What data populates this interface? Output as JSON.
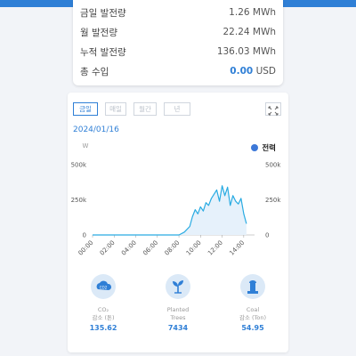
{
  "summary": {
    "rows": [
      {
        "label": "금일 발전량",
        "value": "1.26 MWh"
      },
      {
        "label": "월 발전량",
        "value": "22.24 MWh"
      },
      {
        "label": "누적 발전량",
        "value": "136.03 MWh"
      },
      {
        "label": "총 수입",
        "value_number": "0.00",
        "value_unit": "USD"
      }
    ]
  },
  "tabs": [
    "금일",
    "매일",
    "월간",
    "년"
  ],
  "active_tab": "금일",
  "date": "2024/01/16",
  "colors": {
    "accent": "#2f7fd6",
    "series": "#29abe2",
    "fill": "#e6f1fb"
  },
  "chart_data": {
    "type": "area",
    "unit_label": "W",
    "legend": [
      "전력"
    ],
    "y_ticks": [
      "500k",
      "250k",
      "0"
    ],
    "ylim": [
      0,
      500000
    ],
    "x_ticks": [
      "00:00",
      "02:00",
      "04:00",
      "06:00",
      "08:00",
      "10:00",
      "12:00",
      "14:00"
    ],
    "series": [
      {
        "name": "전력",
        "x": [
          "00:00",
          "01:00",
          "02:00",
          "03:00",
          "04:00",
          "05:00",
          "06:00",
          "07:00",
          "08:00",
          "08:30",
          "09:00",
          "09:15",
          "09:30",
          "09:45",
          "10:00",
          "10:15",
          "10:30",
          "10:45",
          "11:00",
          "11:15",
          "11:30",
          "11:45",
          "12:00",
          "12:15",
          "12:30",
          "12:45",
          "13:00",
          "13:15",
          "13:30",
          "13:45",
          "14:00",
          "14:15"
        ],
        "values": [
          0,
          0,
          0,
          0,
          0,
          0,
          0,
          0,
          0,
          20000,
          60000,
          130000,
          180000,
          150000,
          200000,
          170000,
          230000,
          210000,
          260000,
          290000,
          320000,
          240000,
          350000,
          280000,
          340000,
          210000,
          280000,
          240000,
          220000,
          260000,
          150000,
          80000
        ]
      }
    ]
  },
  "stats": [
    {
      "icon": "co2-icon",
      "label_top": "CO₂",
      "label_bottom": "감소 (톤)",
      "value": "135.62"
    },
    {
      "icon": "plant-icon",
      "label_top": "Planted",
      "label_bottom": "Trees",
      "value": "7434"
    },
    {
      "icon": "coal-icon",
      "label_top": "Coal",
      "label_bottom": "감소 (Ton)",
      "value": "54.95"
    }
  ]
}
